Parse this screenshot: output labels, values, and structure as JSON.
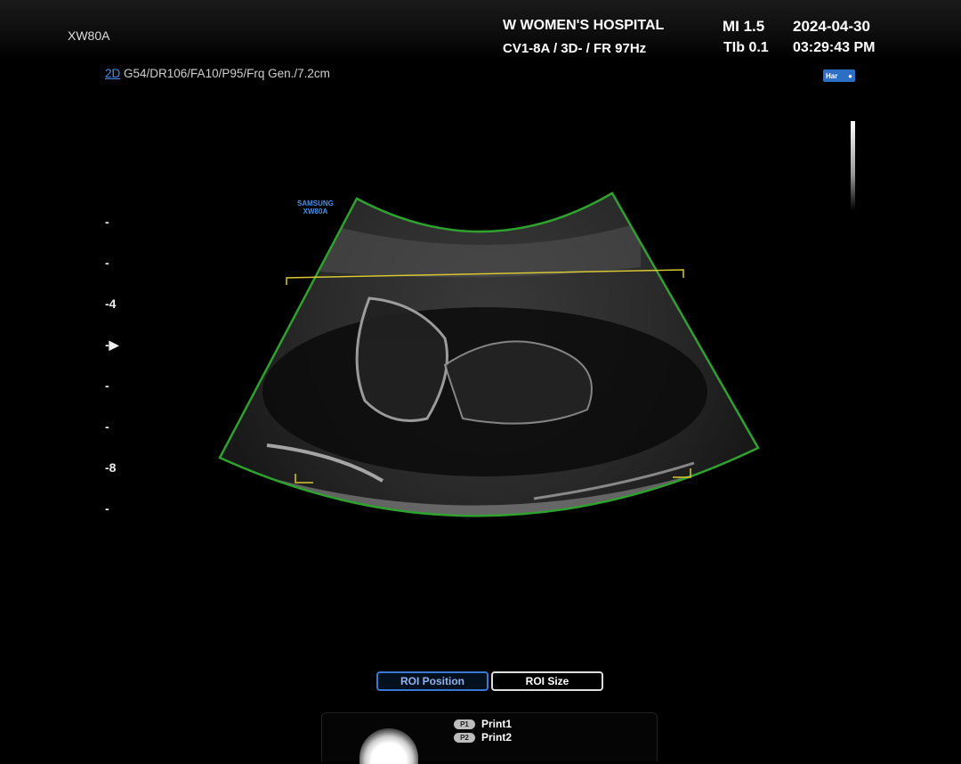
{
  "header": {
    "model": "XW80A",
    "hospital": "W WOMEN'S HOSPITAL",
    "probe_info": "CV1-8A / 3D- / FR 97Hz",
    "mi": "MI  1.5",
    "tib": "TIb 0.1",
    "date": "2024-04-30",
    "time": "03:29:43 PM"
  },
  "imaging": {
    "mode": "2D",
    "params": " G54/DR106/FA10/P95/Frq Gen./7.2cm",
    "har_badge": "Har",
    "brand_line1": "SAMSUNG",
    "brand_line2": "XW80A"
  },
  "depth_scale": {
    "labels": [
      "",
      "",
      "4",
      "",
      "",
      "",
      "8",
      ""
    ],
    "focus_marker_index": 3
  },
  "buttons": {
    "roi_position": "ROI Position",
    "roi_size": "ROI Size"
  },
  "print_panel": {
    "p1_badge": "P1",
    "p1_label": "Print1",
    "p2_badge": "P2",
    "p2_label": "Print2"
  },
  "colors": {
    "roi_outline": "#2fa12f",
    "cut_line": "#d8c832",
    "accent_blue": "#3a78d6"
  },
  "icons": [
    "har-icon",
    "focus-arrow-icon",
    "print-knob-icon"
  ]
}
